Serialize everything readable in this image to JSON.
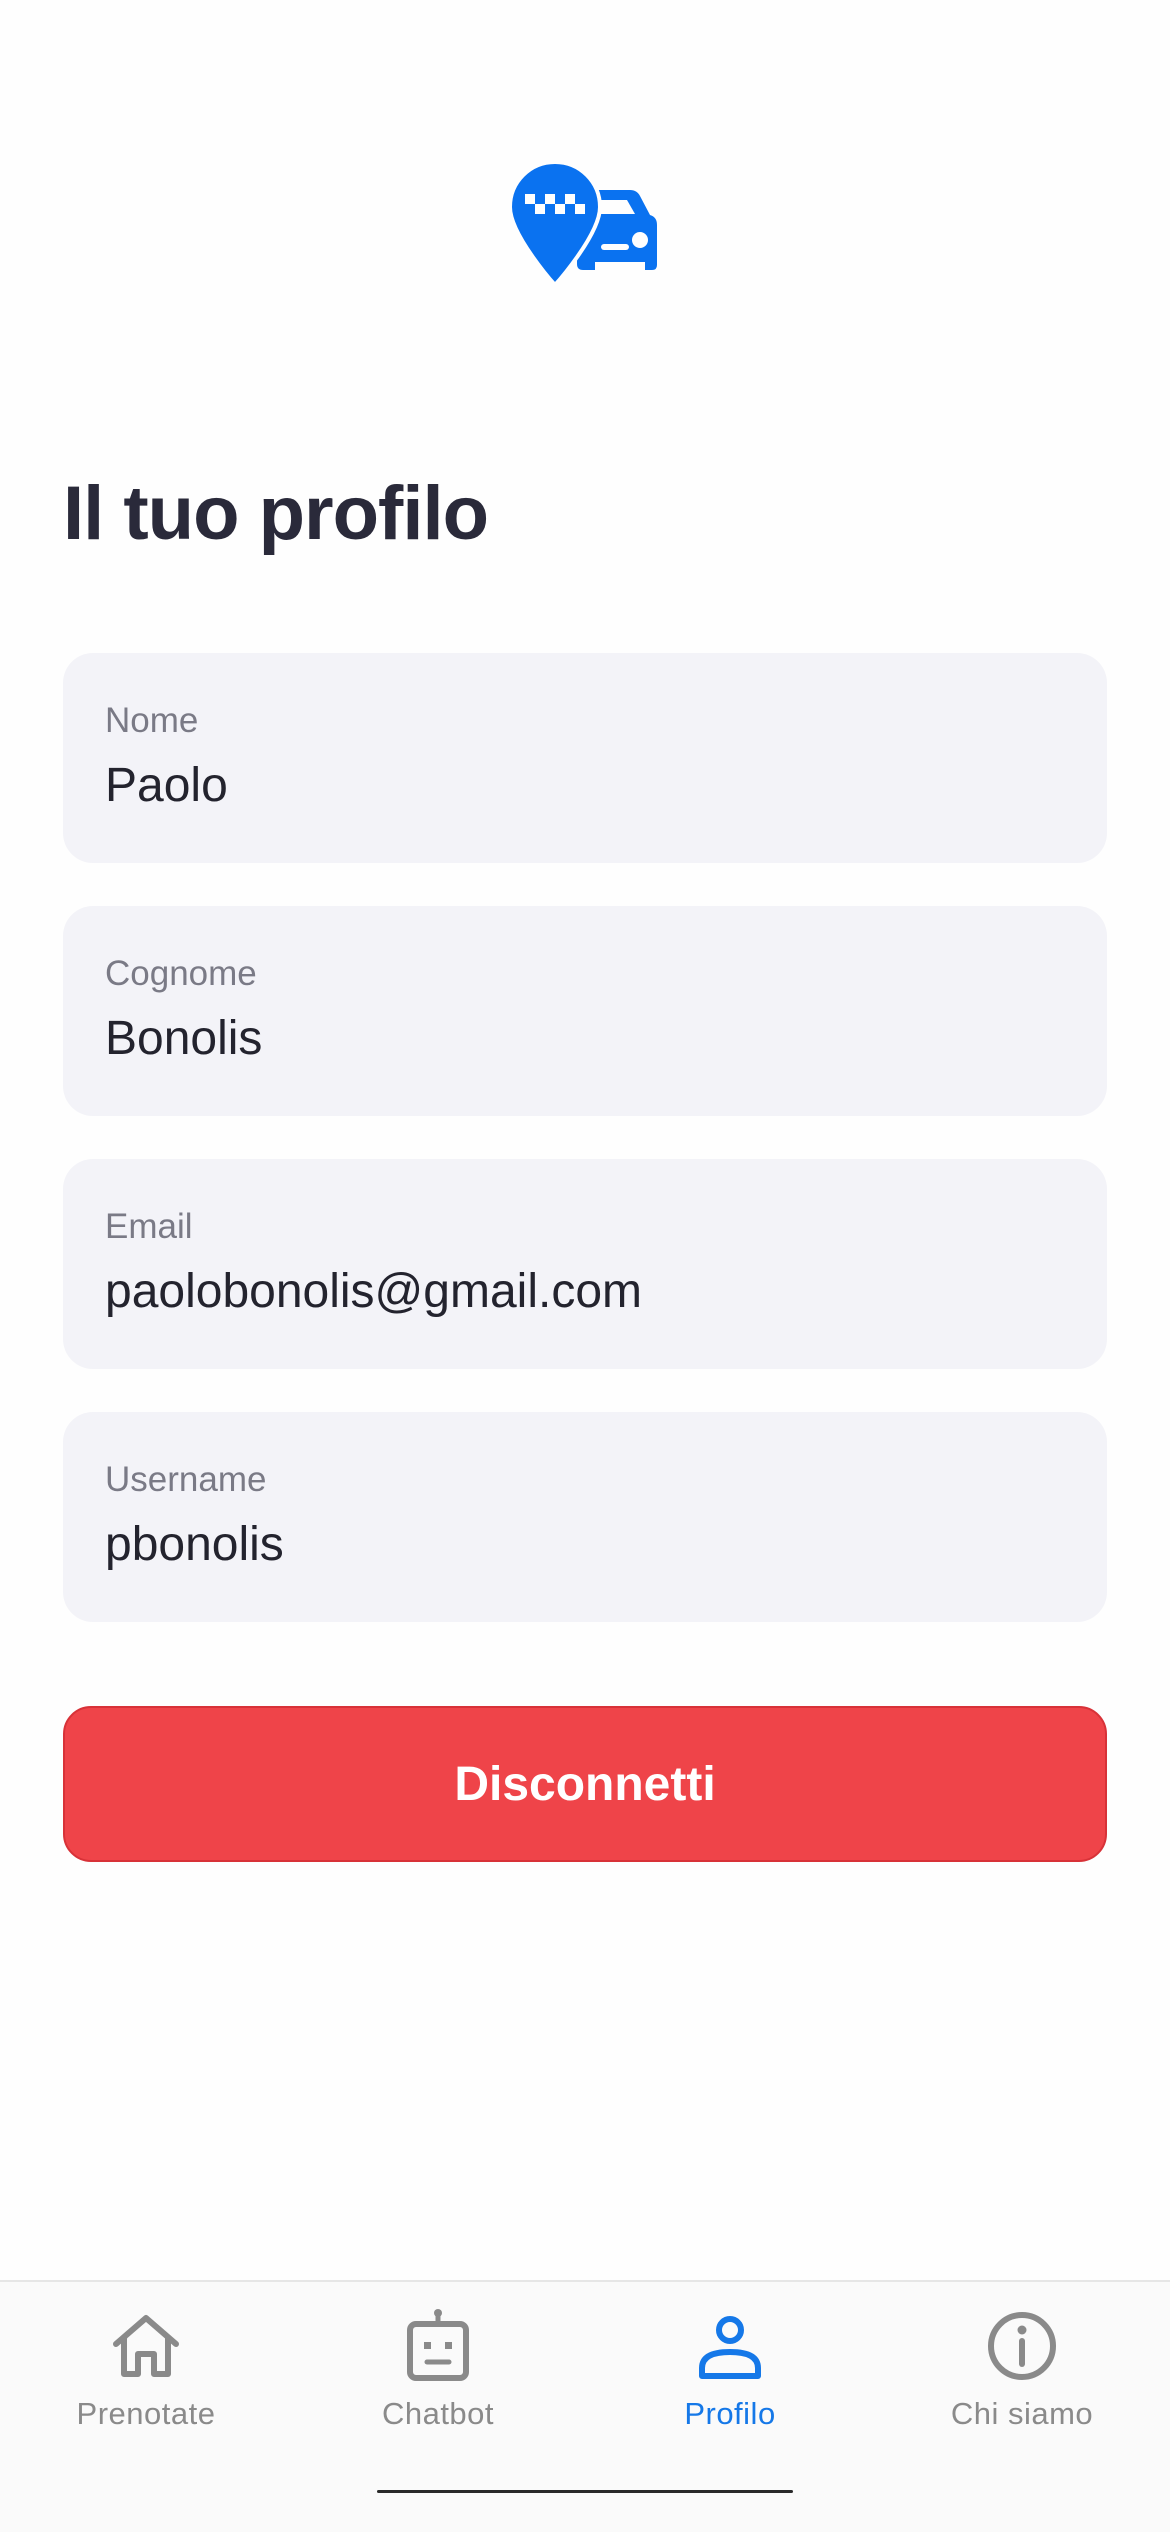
{
  "header": {
    "logo_icon": "taxi-location-pin-icon",
    "brand_color": "#0a72f0"
  },
  "profile": {
    "title": "Il tuo profilo",
    "fields": [
      {
        "label": "Nome",
        "value": "Paolo"
      },
      {
        "label": "Cognome",
        "value": "Bonolis"
      },
      {
        "label": "Email",
        "value": "paolobonolis@gmail.com"
      },
      {
        "label": "Username",
        "value": "pbonolis"
      }
    ],
    "logout_label": "Disconnetti",
    "logout_color": "#ef4449"
  },
  "tabbar": {
    "active_color": "#1578e8",
    "inactive_color": "#8a8a8a",
    "items": [
      {
        "label": "Prenotate",
        "icon": "home-icon",
        "active": false
      },
      {
        "label": "Chatbot",
        "icon": "robot-icon",
        "active": false
      },
      {
        "label": "Profilo",
        "icon": "user-icon",
        "active": true
      },
      {
        "label": "Chi siamo",
        "icon": "info-icon",
        "active": false
      }
    ]
  }
}
